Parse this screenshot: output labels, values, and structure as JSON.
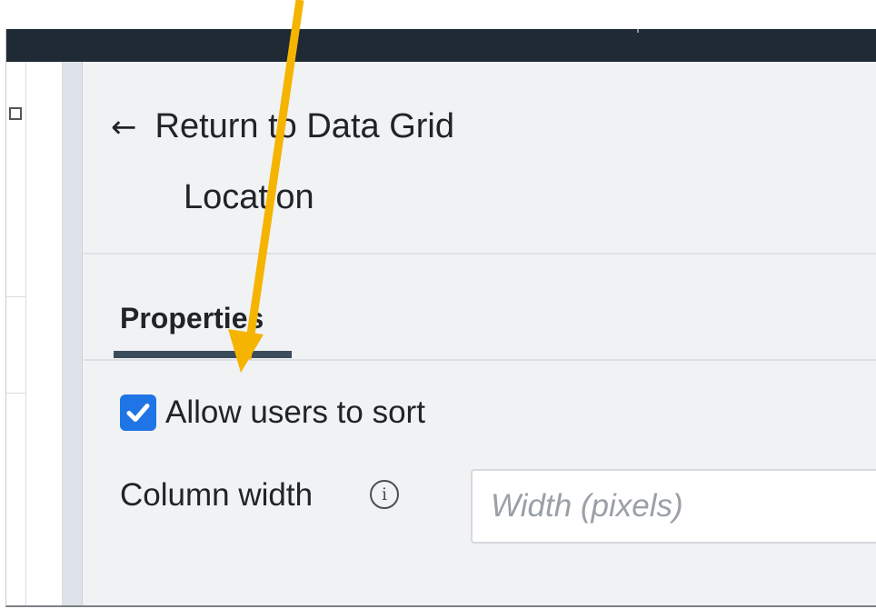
{
  "header": {
    "back_label": "Return to Data Grid",
    "back_icon": "arrow-left-icon",
    "column_name": "Location"
  },
  "tabs": [
    {
      "label": "Properties",
      "active": true
    }
  ],
  "properties": {
    "sort": {
      "label": "Allow users to sort",
      "checked": true
    },
    "column_width": {
      "label": "Column width",
      "info_icon": "info-icon",
      "info_glyph": "i",
      "value": "",
      "placeholder": "Width (pixels)"
    }
  },
  "colors": {
    "top_bar": "#1f2a35",
    "panel_background": "#f1f2f4",
    "checkbox_accent": "#1f75e6",
    "tab_underline": "#3b4c5c",
    "annotation_arrow": "#f5b400"
  }
}
